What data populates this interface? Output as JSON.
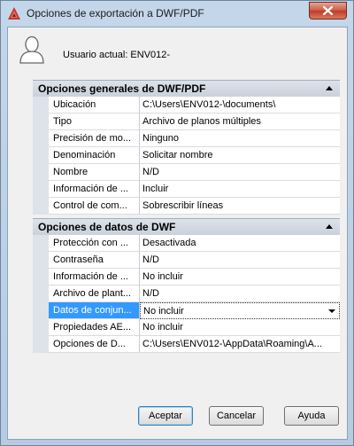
{
  "window": {
    "title": "Opciones de exportación a DWF/PDF"
  },
  "user": {
    "label": "Usuario actual: ENV012-"
  },
  "sections": [
    {
      "title": "Opciones generales de DWF/PDF",
      "rows": [
        {
          "name": "Ubicación",
          "value": "C:\\Users\\ENV012-\\documents\\"
        },
        {
          "name": "Tipo",
          "value": "Archivo de planos múltiples"
        },
        {
          "name": "Precisión de mo...",
          "value": "Ninguno"
        },
        {
          "name": "Denominación",
          "value": "Solicitar nombre"
        },
        {
          "name": "Nombre",
          "value": "N/D"
        },
        {
          "name": "Información de ...",
          "value": "Incluir"
        },
        {
          "name": "Control de com...",
          "value": "Sobrescribir líneas"
        }
      ]
    },
    {
      "title": "Opciones de datos de DWF",
      "rows": [
        {
          "name": "Protección con ...",
          "value": "Desactivada"
        },
        {
          "name": "Contraseña",
          "value": "N/D"
        },
        {
          "name": "Información de ...",
          "value": "No incluir"
        },
        {
          "name": "Archivo de plant...",
          "value": "N/D"
        },
        {
          "name": "Datos de conjun...",
          "value": "No incluir"
        },
        {
          "name": "Propiedades AE...",
          "value": "No incluir"
        },
        {
          "name": "Opciones de D...",
          "value": "C:\\Users\\ENV012-\\AppData\\Roaming\\A..."
        }
      ]
    }
  ],
  "buttons": {
    "accept": "Aceptar",
    "cancel": "Cancelar",
    "help": "Ayuda"
  }
}
